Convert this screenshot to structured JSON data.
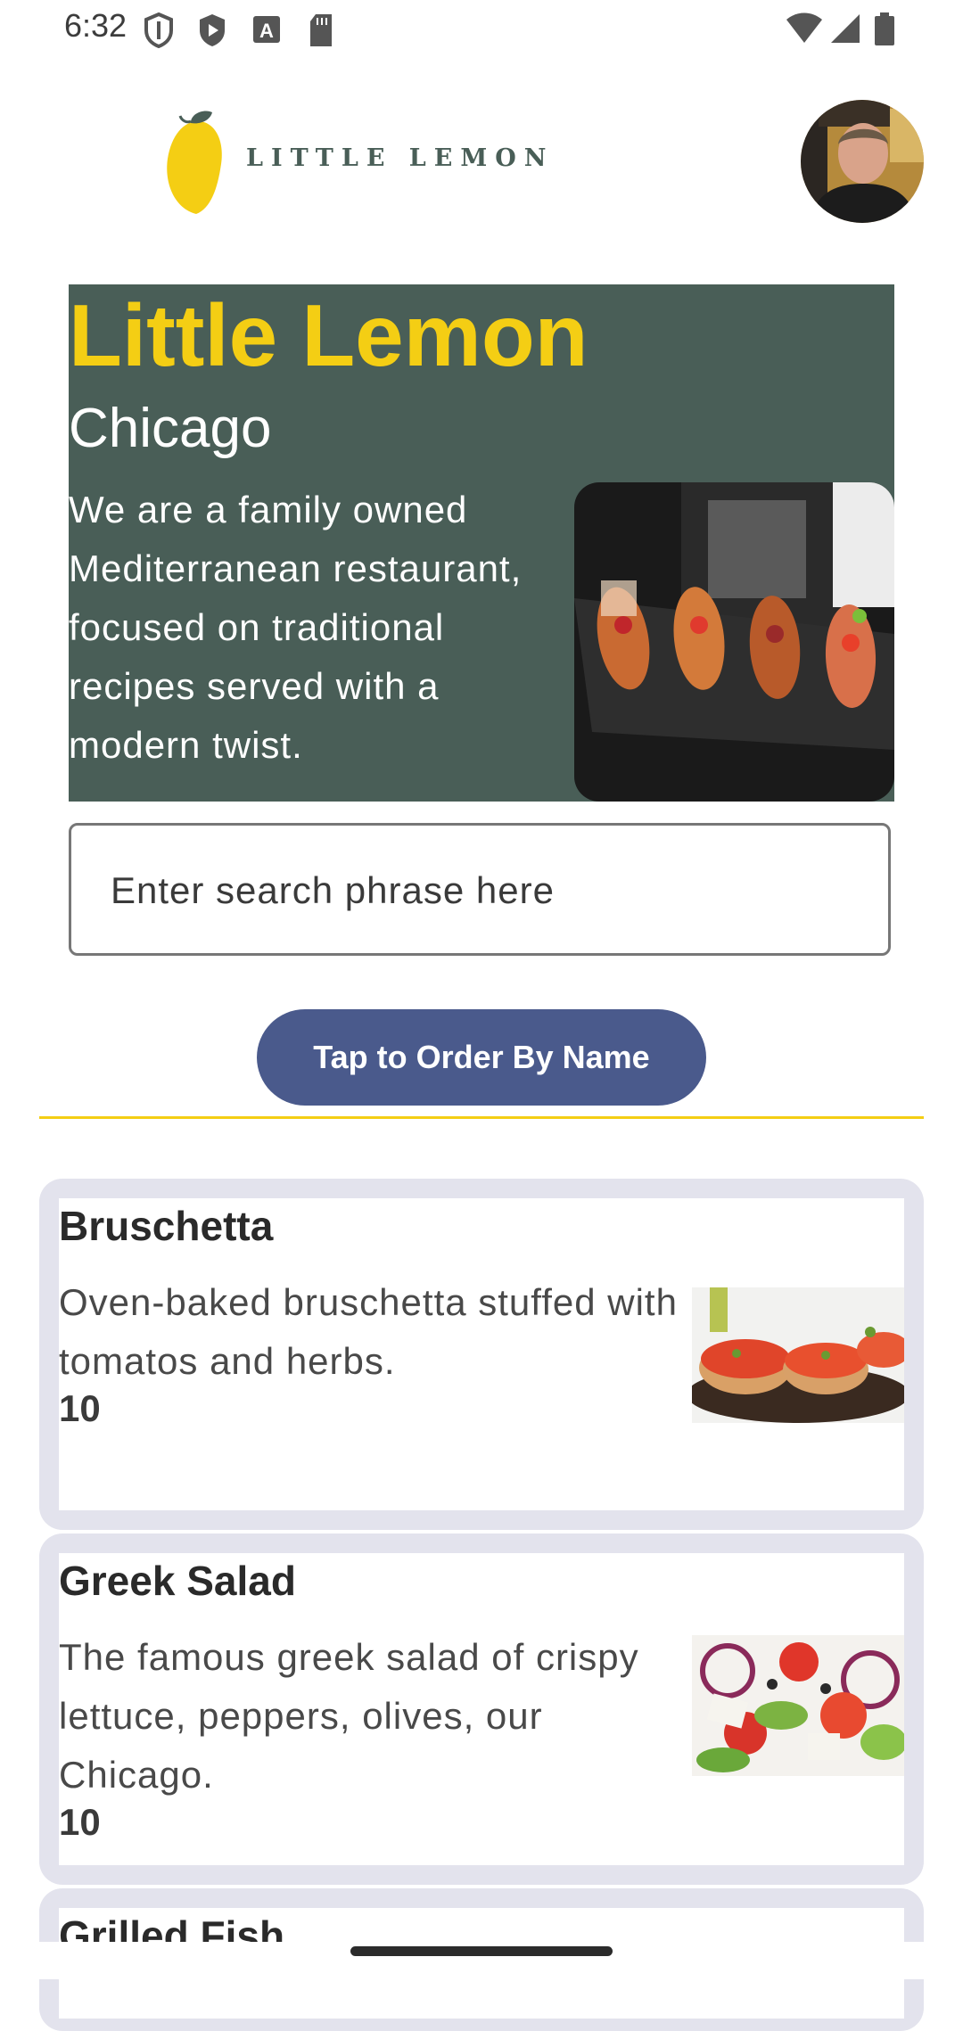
{
  "status_bar": {
    "time": "6:32",
    "left_icons": [
      "shield-icon",
      "play-protect-icon",
      "font-a-icon",
      "sd-card-icon"
    ],
    "right_icons": [
      "wifi-icon",
      "signal-icon",
      "battery-icon"
    ]
  },
  "header": {
    "logo_text": "LITTLE LEMON",
    "avatar": "profile-avatar"
  },
  "hero": {
    "title": "Little Lemon",
    "city": "Chicago",
    "description": "We are a family owned Mediterranean restaurant, focused on traditional recipes served with a modern twist."
  },
  "search": {
    "placeholder": "Enter search phrase here",
    "value": ""
  },
  "order_button": {
    "label": "Tap to Order By Name"
  },
  "menu": {
    "items": [
      {
        "name": "Bruschetta",
        "description": "Oven-baked bruschetta stuffed with tomatos and herbs.",
        "price": "10"
      },
      {
        "name": "Greek Salad",
        "description": "The famous greek salad of crispy lettuce, peppers, olives, our Chicago.",
        "price": "10"
      },
      {
        "name": "Grilled Fish",
        "description": "",
        "price": ""
      }
    ]
  },
  "colors": {
    "brand_green": "#495e57",
    "brand_yellow": "#f4ce14",
    "button_blue": "#4a5a8c",
    "card_border": "#e3e3ed"
  }
}
